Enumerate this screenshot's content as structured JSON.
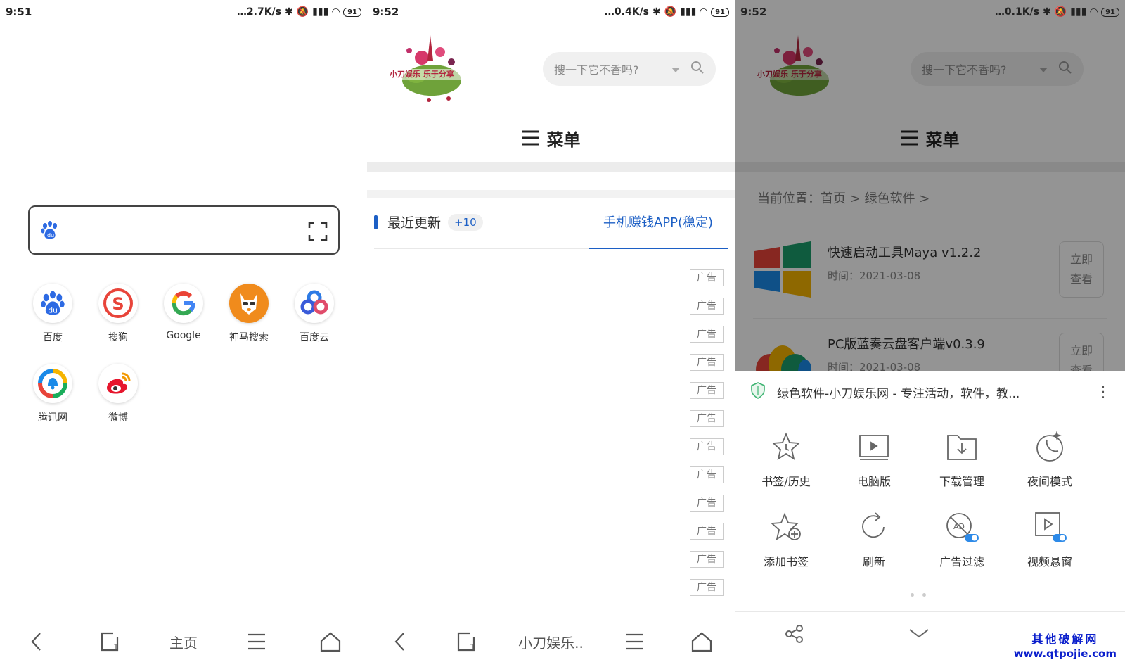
{
  "panel1": {
    "status": {
      "time": "9:51",
      "speed": "2.7K/s",
      "battery": "91"
    },
    "shortcuts": [
      {
        "label": "百度",
        "icon": "baidu-icon"
      },
      {
        "label": "搜狗",
        "icon": "sogou-icon"
      },
      {
        "label": "Google",
        "icon": "google-icon"
      },
      {
        "label": "神马搜索",
        "icon": "shenma-icon"
      },
      {
        "label": "百度云",
        "icon": "baiduyun-icon"
      },
      {
        "label": "腾讯网",
        "icon": "tencent-icon"
      },
      {
        "label": "微博",
        "icon": "weibo-icon"
      }
    ],
    "nav": {
      "home_label": "主页"
    }
  },
  "panel2": {
    "status": {
      "time": "9:52",
      "speed": "0.4K/s",
      "battery": "91"
    },
    "logo_text": "小刀娱乐 乐于分享",
    "search_placeholder": "搜一下它不香吗?",
    "menu_label": "菜单",
    "tabs": {
      "recent": "最近更新",
      "recent_badge": "+10",
      "active": "手机赚钱APP(稳定)"
    },
    "ad_label": "广告",
    "ad_count": 12,
    "nav": {
      "page_label": "小刀娱乐.."
    }
  },
  "panel3": {
    "status": {
      "time": "9:52",
      "speed": "0.1K/s",
      "battery": "91"
    },
    "search_placeholder": "搜一下它不香吗?",
    "menu_label": "菜单",
    "breadcrumb": "当前位置：首页 > 绿色软件 >",
    "articles": [
      {
        "title": "快速启动工具Maya v1.2.2",
        "date": "时间：2021-03-08",
        "button": "立即查看"
      },
      {
        "title": "PC版蓝奏云盘客户端v0.3.9",
        "date": "时间：2021-03-08",
        "button": "立即查看"
      }
    ],
    "sheet_title": "绿色软件-小刀娱乐网 - 专注活动，软件，教...",
    "menu_items": [
      {
        "label": "书签/历史",
        "icon": "bookmark-star-icon"
      },
      {
        "label": "电脑版",
        "icon": "desktop-icon"
      },
      {
        "label": "下载管理",
        "icon": "download-folder-icon"
      },
      {
        "label": "夜间模式",
        "icon": "moon-icon"
      },
      {
        "label": "添加书签",
        "icon": "add-star-icon"
      },
      {
        "label": "刷新",
        "icon": "refresh-icon"
      },
      {
        "label": "广告过滤",
        "icon": "ad-filter-icon"
      },
      {
        "label": "视频悬窗",
        "icon": "video-float-icon"
      }
    ],
    "watermark": {
      "line1": "其他破解网",
      "line2": "www.qtpojie.com"
    }
  }
}
